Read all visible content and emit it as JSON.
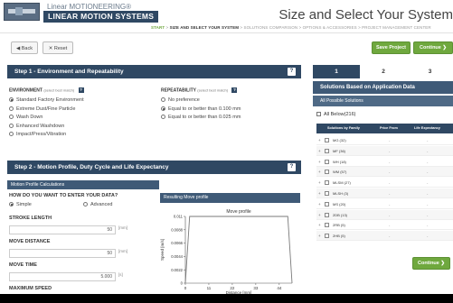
{
  "header": {
    "brand_sub": "Linear MOTIONEERING®",
    "brand_main": "LINEAR MOTION SYSTEMS",
    "page_title": "Size and Select Your System",
    "breadcrumb": {
      "start": "START",
      "sep1": " > ",
      "current": "SIZE AND SELECT YOUR SYSTEM",
      "rest": " > SOLUTIONS COMPARISON > OPTIONS & ACCESSORIES > PROJECT MANAGEMENT CENTER"
    }
  },
  "toolbar": {
    "back": "◀ Back",
    "reset": "✕ Reset",
    "save": "Save Project",
    "continue": "Continue ❯"
  },
  "step1": {
    "title": "Step 1 - Environment and Repeatability",
    "help": "?",
    "environment": {
      "label": "ENVIRONMENT",
      "note": "(select best match)",
      "options": [
        {
          "label": "Standard Factory Environment",
          "selected": true
        },
        {
          "label": "Extreme Dust/Fine Particle",
          "selected": false
        },
        {
          "label": "Wash Down",
          "selected": false
        },
        {
          "label": "Enhanced Washdown",
          "selected": false
        },
        {
          "label": "Impact/Press/Vibration",
          "selected": false
        }
      ]
    },
    "repeatability": {
      "label": "REPEATABILITY",
      "note": "(select best match)",
      "options": [
        {
          "label": "No preference",
          "selected": false
        },
        {
          "label": "Equal to or better than 0.100 mm",
          "selected": true
        },
        {
          "label": "Equal to or better than 0.025 mm",
          "selected": false
        }
      ]
    }
  },
  "step2": {
    "title": "Step 2 - Motion Profile, Duty Cycle and Life Expectancy",
    "help": "?",
    "calc_header": "Motion Profile Calculations",
    "how_label": "HOW DO YOU WANT TO ENTER YOUR DATA?",
    "how_simple": "Simple",
    "how_advanced": "Advanced",
    "stroke_label": "STROKE LENGTH",
    "stroke_value": "50",
    "stroke_unit": "[mm]",
    "move_distance_label": "MOVE DISTANCE",
    "move_distance_value": "50",
    "move_distance_unit": "[mm]",
    "move_time_label": "MOVE TIME",
    "move_time_value": "5.000",
    "move_time_unit": "[s]",
    "max_speed_label": "MAXIMUM SPEED",
    "profile_header": "Resulting Move profile"
  },
  "chart_data": {
    "type": "line",
    "title": "Move profile",
    "xlabel": "Distance [mm]",
    "ylabel": "Speed [m/s]",
    "xlim": [
      0,
      50
    ],
    "ylim": [
      0,
      0.011
    ],
    "x_ticks": [
      "0",
      "11",
      "22",
      "33",
      "44"
    ],
    "y_ticks": [
      "0",
      "0.0022",
      "0.0044",
      "0.0066",
      "0.0088",
      "0.011"
    ],
    "series": [
      {
        "x": [
          0,
          2,
          48,
          50
        ],
        "y": [
          0,
          0.011,
          0.011,
          0
        ]
      }
    ],
    "color": "#7a7a7a"
  },
  "right_panel": {
    "steps": [
      "1",
      "2",
      "3"
    ],
    "title": "Solutions Based on Application Data",
    "all_possible": "All Possible Solutions",
    "all_below": "All Below(216)",
    "columns": [
      "Solutions by Family",
      "Price From",
      "Life Expectancy"
    ],
    "solutions": [
      {
        "name": "MG (32)",
        "price": "-",
        "life": "-"
      },
      {
        "name": "MF (36)",
        "price": "-",
        "life": "-"
      },
      {
        "name": "WH (18)",
        "price": "-",
        "life": "-"
      },
      {
        "name": "WM (57)",
        "price": "-",
        "life": "-"
      },
      {
        "name": "MLSM (27)",
        "price": "-",
        "life": "-"
      },
      {
        "name": "MLSH (3)",
        "price": "-",
        "life": "-"
      },
      {
        "name": "MS (20)",
        "price": "-",
        "life": "-"
      },
      {
        "name": "2DB (13)",
        "price": "-",
        "life": "-"
      },
      {
        "name": "2RB (5)",
        "price": "-",
        "life": "-"
      },
      {
        "name": "2HB (5)",
        "price": "-",
        "life": "-"
      }
    ],
    "continue": "Continue ❯"
  }
}
